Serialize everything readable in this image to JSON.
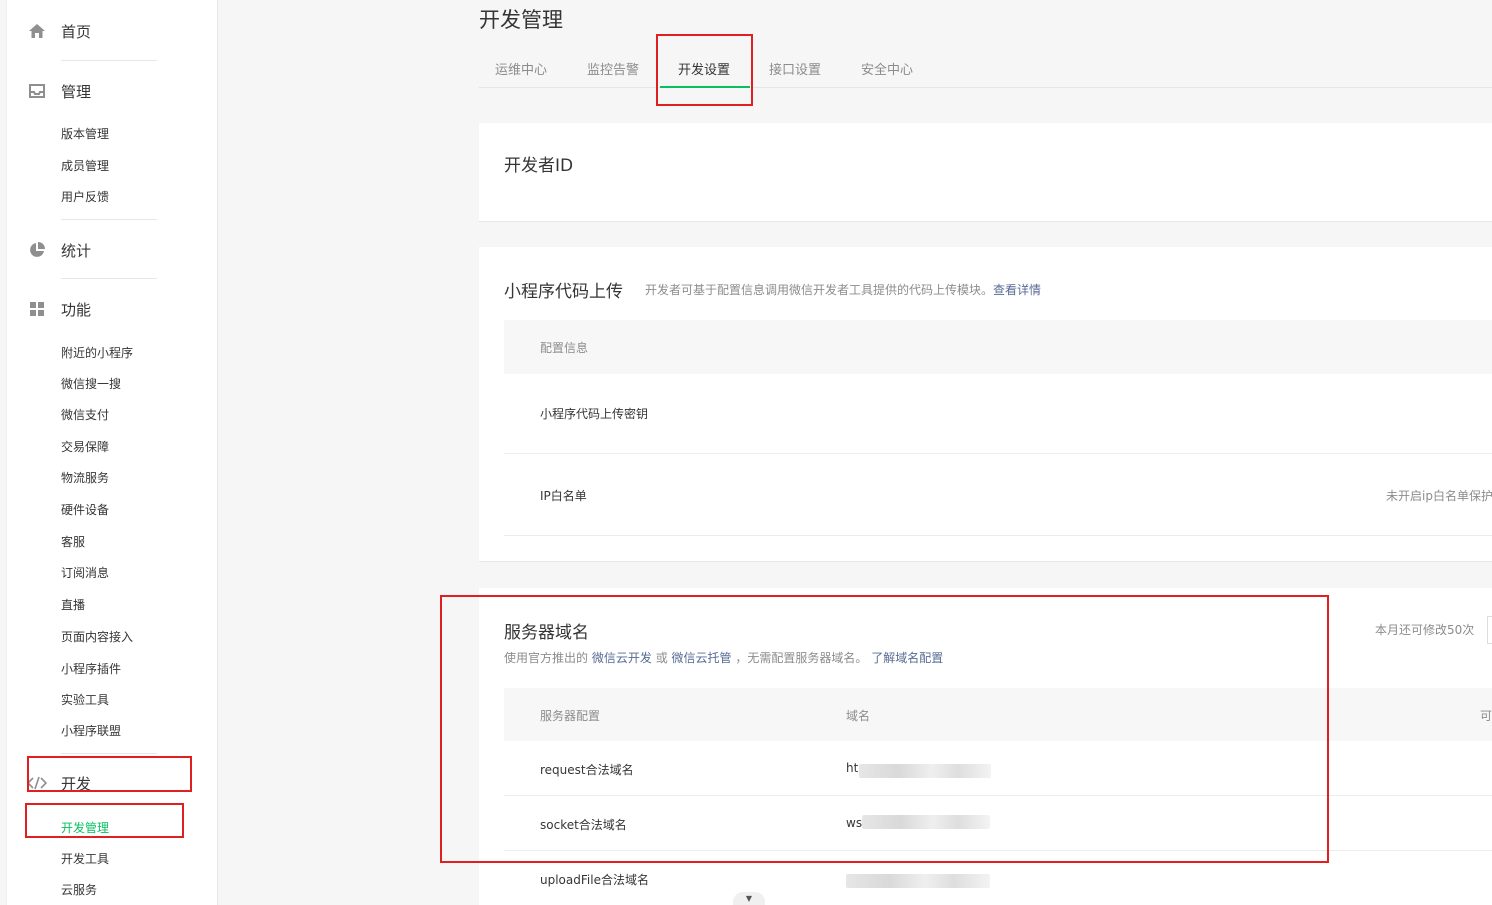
{
  "sidebar": {
    "home": "首页",
    "manage": {
      "label": "管理",
      "items": [
        "版本管理",
        "成员管理",
        "用户反馈"
      ]
    },
    "stats": "统计",
    "features": {
      "label": "功能",
      "items": [
        "附近的小程序",
        "微信搜一搜",
        "微信支付",
        "交易保障",
        "物流服务",
        "硬件设备",
        "客服",
        "订阅消息",
        "直播",
        "页面内容接入",
        "小程序插件",
        "实验工具",
        "小程序联盟"
      ]
    },
    "dev": {
      "label": "开发",
      "items": [
        "开发管理",
        "开发工具",
        "云服务"
      ]
    },
    "icons": {
      "home": "home-icon",
      "manage": "inbox-icon",
      "stats": "pie-chart-icon",
      "features": "grid-icon",
      "dev": "code-icon"
    }
  },
  "main": {
    "title": "开发管理",
    "tabs": [
      "运维中心",
      "监控告警",
      "开发设置",
      "接口设置",
      "安全中心"
    ],
    "developer_id": {
      "title": "开发者ID"
    },
    "upload": {
      "title": "小程序代码上传",
      "desc": "开发者可基于配置信息调用微信开发者工具提供的代码上传模块。",
      "link": "查看详情",
      "header": "配置信息",
      "rows": [
        {
          "label": "小程序代码上传密钥",
          "value": ""
        },
        {
          "label": "IP白名单",
          "value": "未开启ip白名单保护"
        }
      ]
    },
    "server": {
      "title": "服务器域名",
      "quota": "本月还可修改50次",
      "desc_prefix": "使用官方推出的",
      "desc_link1": "微信云开发",
      "desc_or": "或",
      "desc_link2": "微信云托管",
      "desc_suffix": "，无需配置服务器域名。",
      "desc_link3": "了解域名配置",
      "columns": [
        "服务器配置",
        "域名",
        "可"
      ],
      "rows": [
        {
          "name": "request合法域名",
          "value": "ht"
        },
        {
          "name": "socket合法域名",
          "value": "ws"
        },
        {
          "name": "uploadFile合法域名",
          "value": ""
        }
      ]
    }
  },
  "colors": {
    "accent": "#07c160",
    "link": "#576b95",
    "highlight": "#e02020"
  }
}
